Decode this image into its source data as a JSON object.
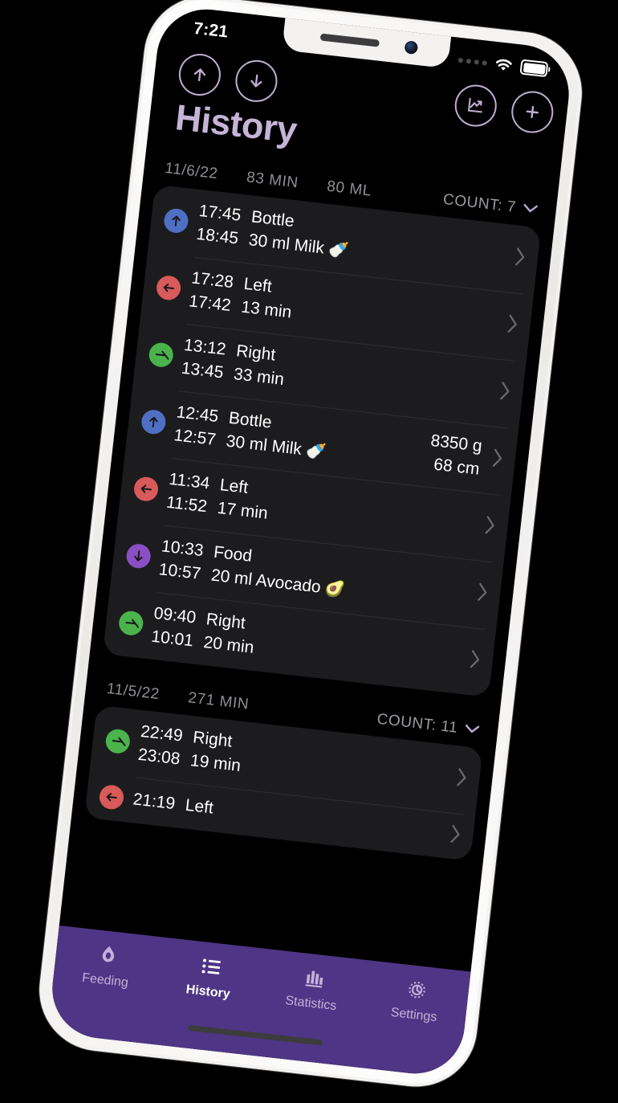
{
  "status_bar": {
    "time": "7:21",
    "signal_icon": "signal-dots-icon",
    "wifi_icon": "wifi-icon",
    "battery_icon": "battery-full-icon"
  },
  "nav": {
    "scroll_up_icon": "arrow-up-circle-icon",
    "scroll_down_icon": "arrow-down-circle-icon",
    "statistics_icon": "chart-uptrend-circle-icon",
    "add_icon": "plus-circle-icon"
  },
  "header": {
    "title": "History",
    "title_color": "#c5b4d8"
  },
  "colors": {
    "screen_background": "#000000",
    "card_background": "#1c1c1e",
    "accent_purple": "#4f3585",
    "bottle_blue": "#4f6fc4",
    "left_red": "#d85a5a",
    "right_green": "#4bb34b",
    "food_purple": "#8a4fc4",
    "secondary_text": "#8e8e93"
  },
  "sections": [
    {
      "date": "11/6/22",
      "minutes": "83 MIN",
      "volume": "80 ML",
      "count_label": "COUNT: 7",
      "collapse_icon": "chevron-down-icon",
      "entries": [
        {
          "kind": "bottle",
          "icon": "arrow-up-icon",
          "start_time": "17:45",
          "end_time": "18:45",
          "title": "Bottle",
          "detail": "30 ml Milk",
          "emoji": "🍼",
          "metrics": [],
          "disclosure_icon": "chevron-right-icon"
        },
        {
          "kind": "left",
          "icon": "arrow-left-icon",
          "start_time": "17:28",
          "end_time": "17:42",
          "title": "Left",
          "detail": "13 min",
          "emoji": "",
          "metrics": [],
          "disclosure_icon": "chevron-right-icon"
        },
        {
          "kind": "right",
          "icon": "arrow-right-icon",
          "start_time": "13:12",
          "end_time": "13:45",
          "title": "Right",
          "detail": "33 min",
          "emoji": "",
          "metrics": [],
          "disclosure_icon": "chevron-right-icon"
        },
        {
          "kind": "bottle",
          "icon": "arrow-up-icon",
          "start_time": "12:45",
          "end_time": "12:57",
          "title": "Bottle",
          "detail": "30 ml Milk",
          "emoji": "🍼",
          "metrics": [
            "8350 g",
            "68 cm"
          ],
          "disclosure_icon": "chevron-right-icon"
        },
        {
          "kind": "left",
          "icon": "arrow-left-icon",
          "start_time": "11:34",
          "end_time": "11:52",
          "title": "Left",
          "detail": "17 min",
          "emoji": "",
          "metrics": [],
          "disclosure_icon": "chevron-right-icon"
        },
        {
          "kind": "food",
          "icon": "arrow-down-icon",
          "start_time": "10:33",
          "end_time": "10:57",
          "title": "Food",
          "detail": "20 ml Avocado",
          "emoji": "🥑",
          "metrics": [],
          "disclosure_icon": "chevron-right-icon"
        },
        {
          "kind": "right",
          "icon": "arrow-right-icon",
          "start_time": "09:40",
          "end_time": "10:01",
          "title": "Right",
          "detail": "20 min",
          "emoji": "",
          "metrics": [],
          "disclosure_icon": "chevron-right-icon"
        }
      ]
    },
    {
      "date": "11/5/22",
      "minutes": "271 MIN",
      "volume": "",
      "count_label": "COUNT: 11",
      "collapse_icon": "chevron-down-icon",
      "entries": [
        {
          "kind": "right",
          "icon": "arrow-right-icon",
          "start_time": "22:49",
          "end_time": "23:08",
          "title": "Right",
          "detail": "19 min",
          "emoji": "",
          "metrics": [],
          "disclosure_icon": "chevron-right-icon"
        },
        {
          "kind": "left",
          "icon": "arrow-left-icon",
          "start_time": "21:19",
          "end_time": "",
          "title": "Left",
          "detail": "",
          "emoji": "",
          "metrics": [],
          "disclosure_icon": "chevron-right-icon"
        }
      ]
    }
  ],
  "tab_bar": {
    "items": [
      {
        "label": "Feeding",
        "icon": "droplet-icon",
        "active": false
      },
      {
        "label": "History",
        "icon": "list-icon",
        "active": true
      },
      {
        "label": "Statistics",
        "icon": "bar-chart-icon",
        "active": false
      },
      {
        "label": "Settings",
        "icon": "gear-icon",
        "active": false
      }
    ]
  }
}
